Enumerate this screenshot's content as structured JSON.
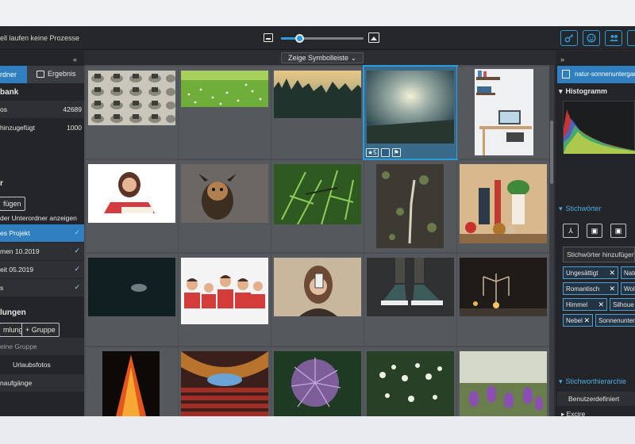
{
  "topbar": {
    "status": "ell laufen keine Prozesse",
    "zoom_percent": 22,
    "icons": [
      "key-icon",
      "face-icon",
      "people-icon",
      "more-icon"
    ]
  },
  "left": {
    "collapse": "«",
    "tabs": {
      "folders": "rdner",
      "results": "Ergebnis"
    },
    "database_heading": "bank",
    "stats": [
      {
        "label": "os",
        "value": "42689"
      },
      {
        "label": "hinzugefügt",
        "value": "1000"
      }
    ],
    "section2_letter": "r",
    "add_button": "fügen",
    "subfolders_toggle": "der Unterordner anzeigen",
    "folder_items": [
      {
        "label": "es Projekt",
        "checked": "✓"
      },
      {
        "label": "men 10.2019",
        "checked": "✓"
      },
      {
        "label": "eit 05.2019",
        "checked": "✓"
      },
      {
        "label": "s",
        "checked": "✓"
      }
    ],
    "collections_heading": "lungen",
    "collection_button": "mlung",
    "group_button": "+ Gruppe",
    "collection_items": [
      "eine Gruppe",
      "Urlaubsfotos",
      "naufgänge"
    ]
  },
  "center": {
    "symbol_bar_label": "Zeige Symbolleiste",
    "selected_rating": "5"
  },
  "right": {
    "collapse": "»",
    "active_tab": "natur-sonnenuntergang",
    "histogram_heading": "Histogramm",
    "keywords_heading": "Stichwörter",
    "keyword_input_placeholder": "Stichwörter hinzufügen",
    "keyword_tags": [
      {
        "label": "Ungesättigt"
      },
      {
        "label": "Natu"
      },
      {
        "label": "Romantisch"
      },
      {
        "label": "Wolk"
      },
      {
        "label": "Himmel"
      },
      {
        "label": "Silhoue"
      },
      {
        "label": "Nebel"
      },
      {
        "label": "Sonnenunter"
      }
    ],
    "hierarchy_heading": "Stichworthierarchie",
    "hierarchy_items": [
      "Benutzerdefiniert",
      "Excire"
    ]
  },
  "colors": {
    "accent": "#2d9bdc",
    "selection": "#2f7fc1",
    "panel": "#232528",
    "grid_bg": "#4b4e53"
  }
}
